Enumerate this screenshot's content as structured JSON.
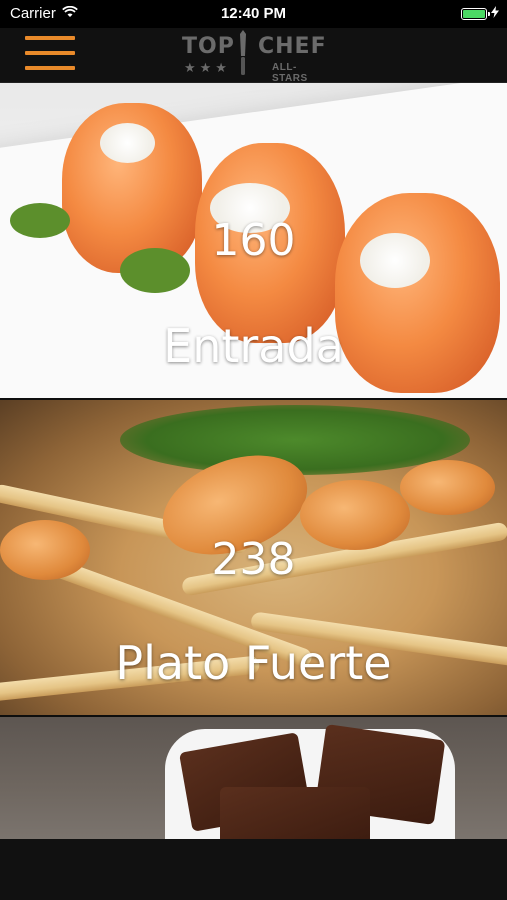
{
  "status_bar": {
    "carrier": "Carrier",
    "time": "12:40 PM",
    "battery_level": 1.0
  },
  "nav": {
    "menu_icon": "hamburger-menu-icon",
    "logo": {
      "top": "TOP",
      "chef": "CHEF",
      "stars": "★★★",
      "subtitle": "ALL-STARS"
    },
    "accent_color": "#e98a2a"
  },
  "categories": [
    {
      "count": "160",
      "name": "Entrada"
    },
    {
      "count": "238",
      "name": "Plato Fuerte"
    },
    {
      "count": "",
      "name": ""
    }
  ]
}
